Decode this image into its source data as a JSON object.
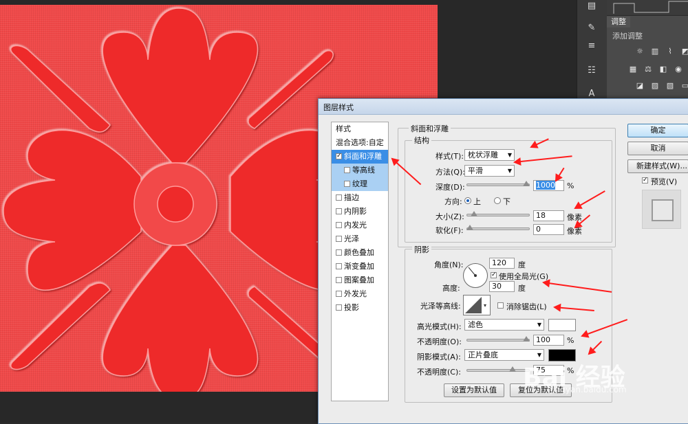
{
  "dialog": {
    "title": "图层样式",
    "styles_header": "样式",
    "styles": [
      {
        "label": "混合选项:自定",
        "checkbox": false,
        "checked": false,
        "state": "normal",
        "indent": false
      },
      {
        "label": "斜面和浮雕",
        "checkbox": true,
        "checked": true,
        "state": "selected",
        "indent": false
      },
      {
        "label": "等高线",
        "checkbox": true,
        "checked": false,
        "state": "sub",
        "indent": true
      },
      {
        "label": "纹理",
        "checkbox": true,
        "checked": false,
        "state": "sub",
        "indent": true
      },
      {
        "label": "描边",
        "checkbox": true,
        "checked": false,
        "state": "normal",
        "indent": false
      },
      {
        "label": "内阴影",
        "checkbox": true,
        "checked": false,
        "state": "normal",
        "indent": false
      },
      {
        "label": "内发光",
        "checkbox": true,
        "checked": false,
        "state": "normal",
        "indent": false
      },
      {
        "label": "光泽",
        "checkbox": true,
        "checked": false,
        "state": "normal",
        "indent": false
      },
      {
        "label": "颜色叠加",
        "checkbox": true,
        "checked": false,
        "state": "normal",
        "indent": false
      },
      {
        "label": "渐变叠加",
        "checkbox": true,
        "checked": false,
        "state": "normal",
        "indent": false
      },
      {
        "label": "图案叠加",
        "checkbox": true,
        "checked": false,
        "state": "normal",
        "indent": false
      },
      {
        "label": "外发光",
        "checkbox": true,
        "checked": false,
        "state": "normal",
        "indent": false
      },
      {
        "label": "投影",
        "checkbox": true,
        "checked": false,
        "state": "normal",
        "indent": false
      }
    ],
    "bevel": {
      "section_title": "斜面和浮雕",
      "structure_title": "结构",
      "style_label": "样式(T):",
      "style_value": "枕状浮雕",
      "technique_label": "方法(Q):",
      "technique_value": "平滑",
      "depth_label": "深度(D):",
      "depth_value": "1000",
      "depth_unit": "%",
      "depth_level": 1.0,
      "direction_label": "方向:",
      "direction_up": "上",
      "direction_down": "下",
      "size_label": "大小(Z):",
      "size_value": "18",
      "size_unit": "像素",
      "size_level": 0.07,
      "soften_label": "软化(F):",
      "soften_value": "0",
      "soften_unit": "像素",
      "soften_level": 0.0
    },
    "shading": {
      "title": "阴影",
      "angle_label": "角度(N):",
      "angle_value": "120",
      "angle_unit": "度",
      "global_light_label": "使用全局光(G)",
      "global_light_checked": true,
      "altitude_label": "高度:",
      "altitude_value": "30",
      "altitude_unit": "度",
      "gloss_label": "光泽等高线:",
      "antialias_label": "消除锯齿(L)",
      "highlight_label": "高光模式(H):",
      "highlight_mode": "滤色",
      "highlight_color": "#ffffff",
      "hl_opacity_label": "不透明度(O):",
      "hl_opacity_value": "100",
      "hl_opacity_unit": "%",
      "hl_opacity_level": 1.0,
      "shadow_label": "阴影模式(A):",
      "shadow_mode": "正片叠底",
      "shadow_color": "#000000",
      "sh_opacity_label": "不透明度(C):",
      "sh_opacity_value": "75",
      "sh_opacity_unit": "%",
      "sh_opacity_level": 0.75
    },
    "buttons": {
      "ok": "确定",
      "cancel": "取消",
      "new_style": "新建样式(W)...",
      "preview": "预览(V)",
      "preview_checked": true,
      "make_default": "设置为默认值",
      "reset_default": "复位为默认值"
    }
  },
  "panel": {
    "tab": "调整",
    "add_adjustment": "添加调整",
    "icons": [
      "brightness-icon",
      "levels-icon",
      "curves-icon",
      "exposure-icon",
      "vibrance-icon",
      "hue-icon",
      "balance-icon",
      "bw-icon",
      "photo-filter-icon",
      "channel-mixer-icon",
      "invert-icon",
      "posterize-icon",
      "threshold-icon",
      "gradient-map-icon"
    ]
  },
  "tools": [
    "layers-icon",
    "brush-icon",
    "sliders-icon",
    "properties-icon",
    "font-icon"
  ],
  "watermark": {
    "main": "Bai 经验",
    "sub": "jingyan.baidu.com"
  },
  "colors": {
    "artwork": "#f04848",
    "shape": "#ee2222",
    "selection": "#3a8ee6",
    "annotation": "#ff1c1c"
  }
}
